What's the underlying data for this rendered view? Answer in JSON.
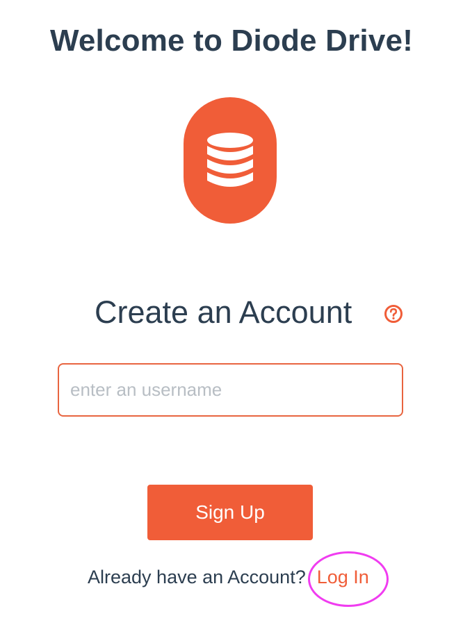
{
  "header": {
    "title": "Welcome to Diode Drive!"
  },
  "logo": {
    "icon": "database-icon",
    "color": "#f05d38"
  },
  "form": {
    "heading": "Create an Account",
    "help_icon": "question-circle-icon",
    "username_placeholder": "enter an username",
    "username_value": "",
    "submit_label": "Sign Up"
  },
  "footer": {
    "prompt": "Already have an Account?",
    "login_label": "Log In"
  },
  "colors": {
    "accent": "#f05d38",
    "text": "#2c3e50",
    "highlight": "#f03cf0"
  }
}
